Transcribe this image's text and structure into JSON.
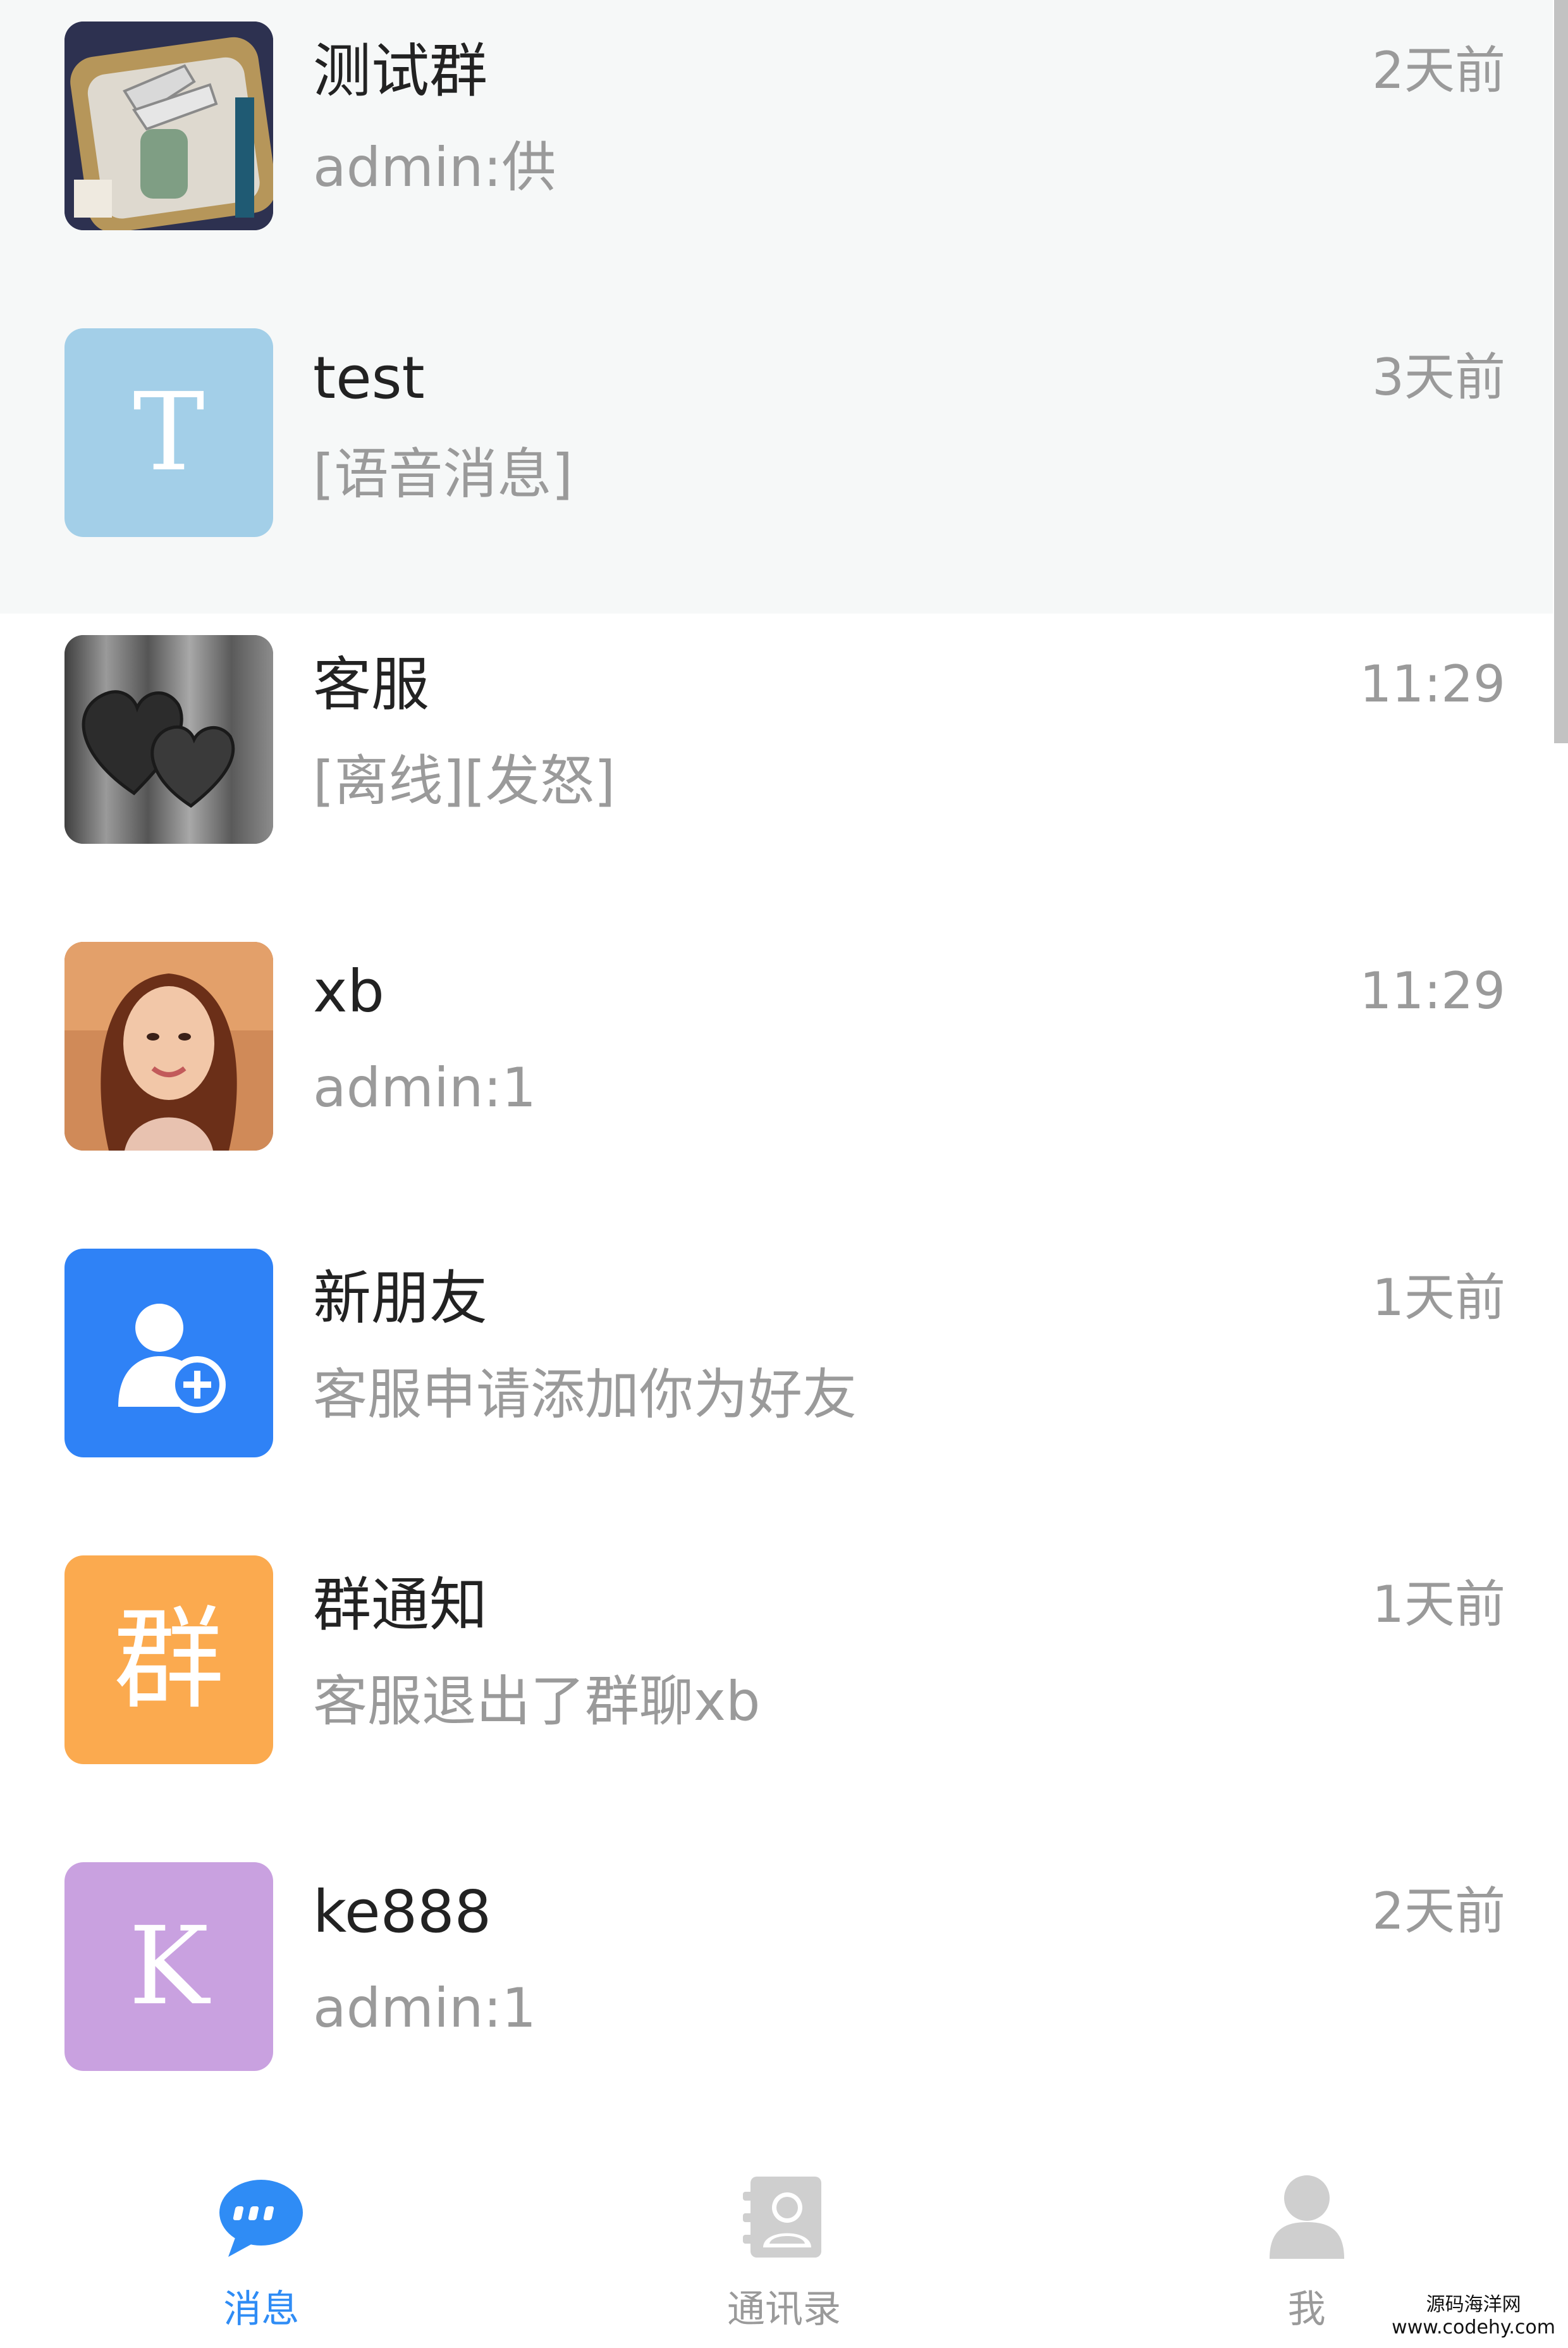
{
  "conversations": [
    {
      "name": "测试群",
      "preview": "admin:供",
      "time": "2天前",
      "avatar": "image",
      "avatar_desc": "photo-icon"
    },
    {
      "name": "test",
      "preview": "[语音消息]",
      "time": "3天前",
      "avatar": "letter",
      "letter": "T",
      "color": "#a3cfe8"
    },
    {
      "name": "客服",
      "preview": "[离线][发怒]",
      "time": "11:29",
      "avatar": "image",
      "avatar_desc": "hearts-icon"
    },
    {
      "name": "xb",
      "preview": "admin:1",
      "time": "11:29",
      "avatar": "image",
      "avatar_desc": "portrait-icon"
    },
    {
      "name": "新朋友",
      "preview": "客服申请添加你为好友",
      "time": "1天前",
      "avatar": "icon",
      "avatar_desc": "add-friend-icon",
      "color": "#2f82f6"
    },
    {
      "name": "群通知",
      "preview": "客服退出了群聊xb",
      "time": "1天前",
      "avatar": "letter",
      "letter": "群",
      "color": "#fbaa4f"
    },
    {
      "name": "ke888",
      "preview": "admin:1",
      "time": "2天前",
      "avatar": "letter",
      "letter": "K",
      "color": "#c9a1e0"
    }
  ],
  "tabs": [
    {
      "label": "消息",
      "icon": "chat-bubble-icon",
      "active": true
    },
    {
      "label": "通讯录",
      "icon": "contacts-icon",
      "active": false
    },
    {
      "label": "我",
      "icon": "profile-icon",
      "active": false
    }
  ],
  "watermark": {
    "line1": "源码海洋网",
    "line2": "www.codehy.com"
  },
  "colors": {
    "accent": "#2f8cf5",
    "pinned_bg": "#f6f8f8",
    "muted_text": "#9a9a9a"
  }
}
